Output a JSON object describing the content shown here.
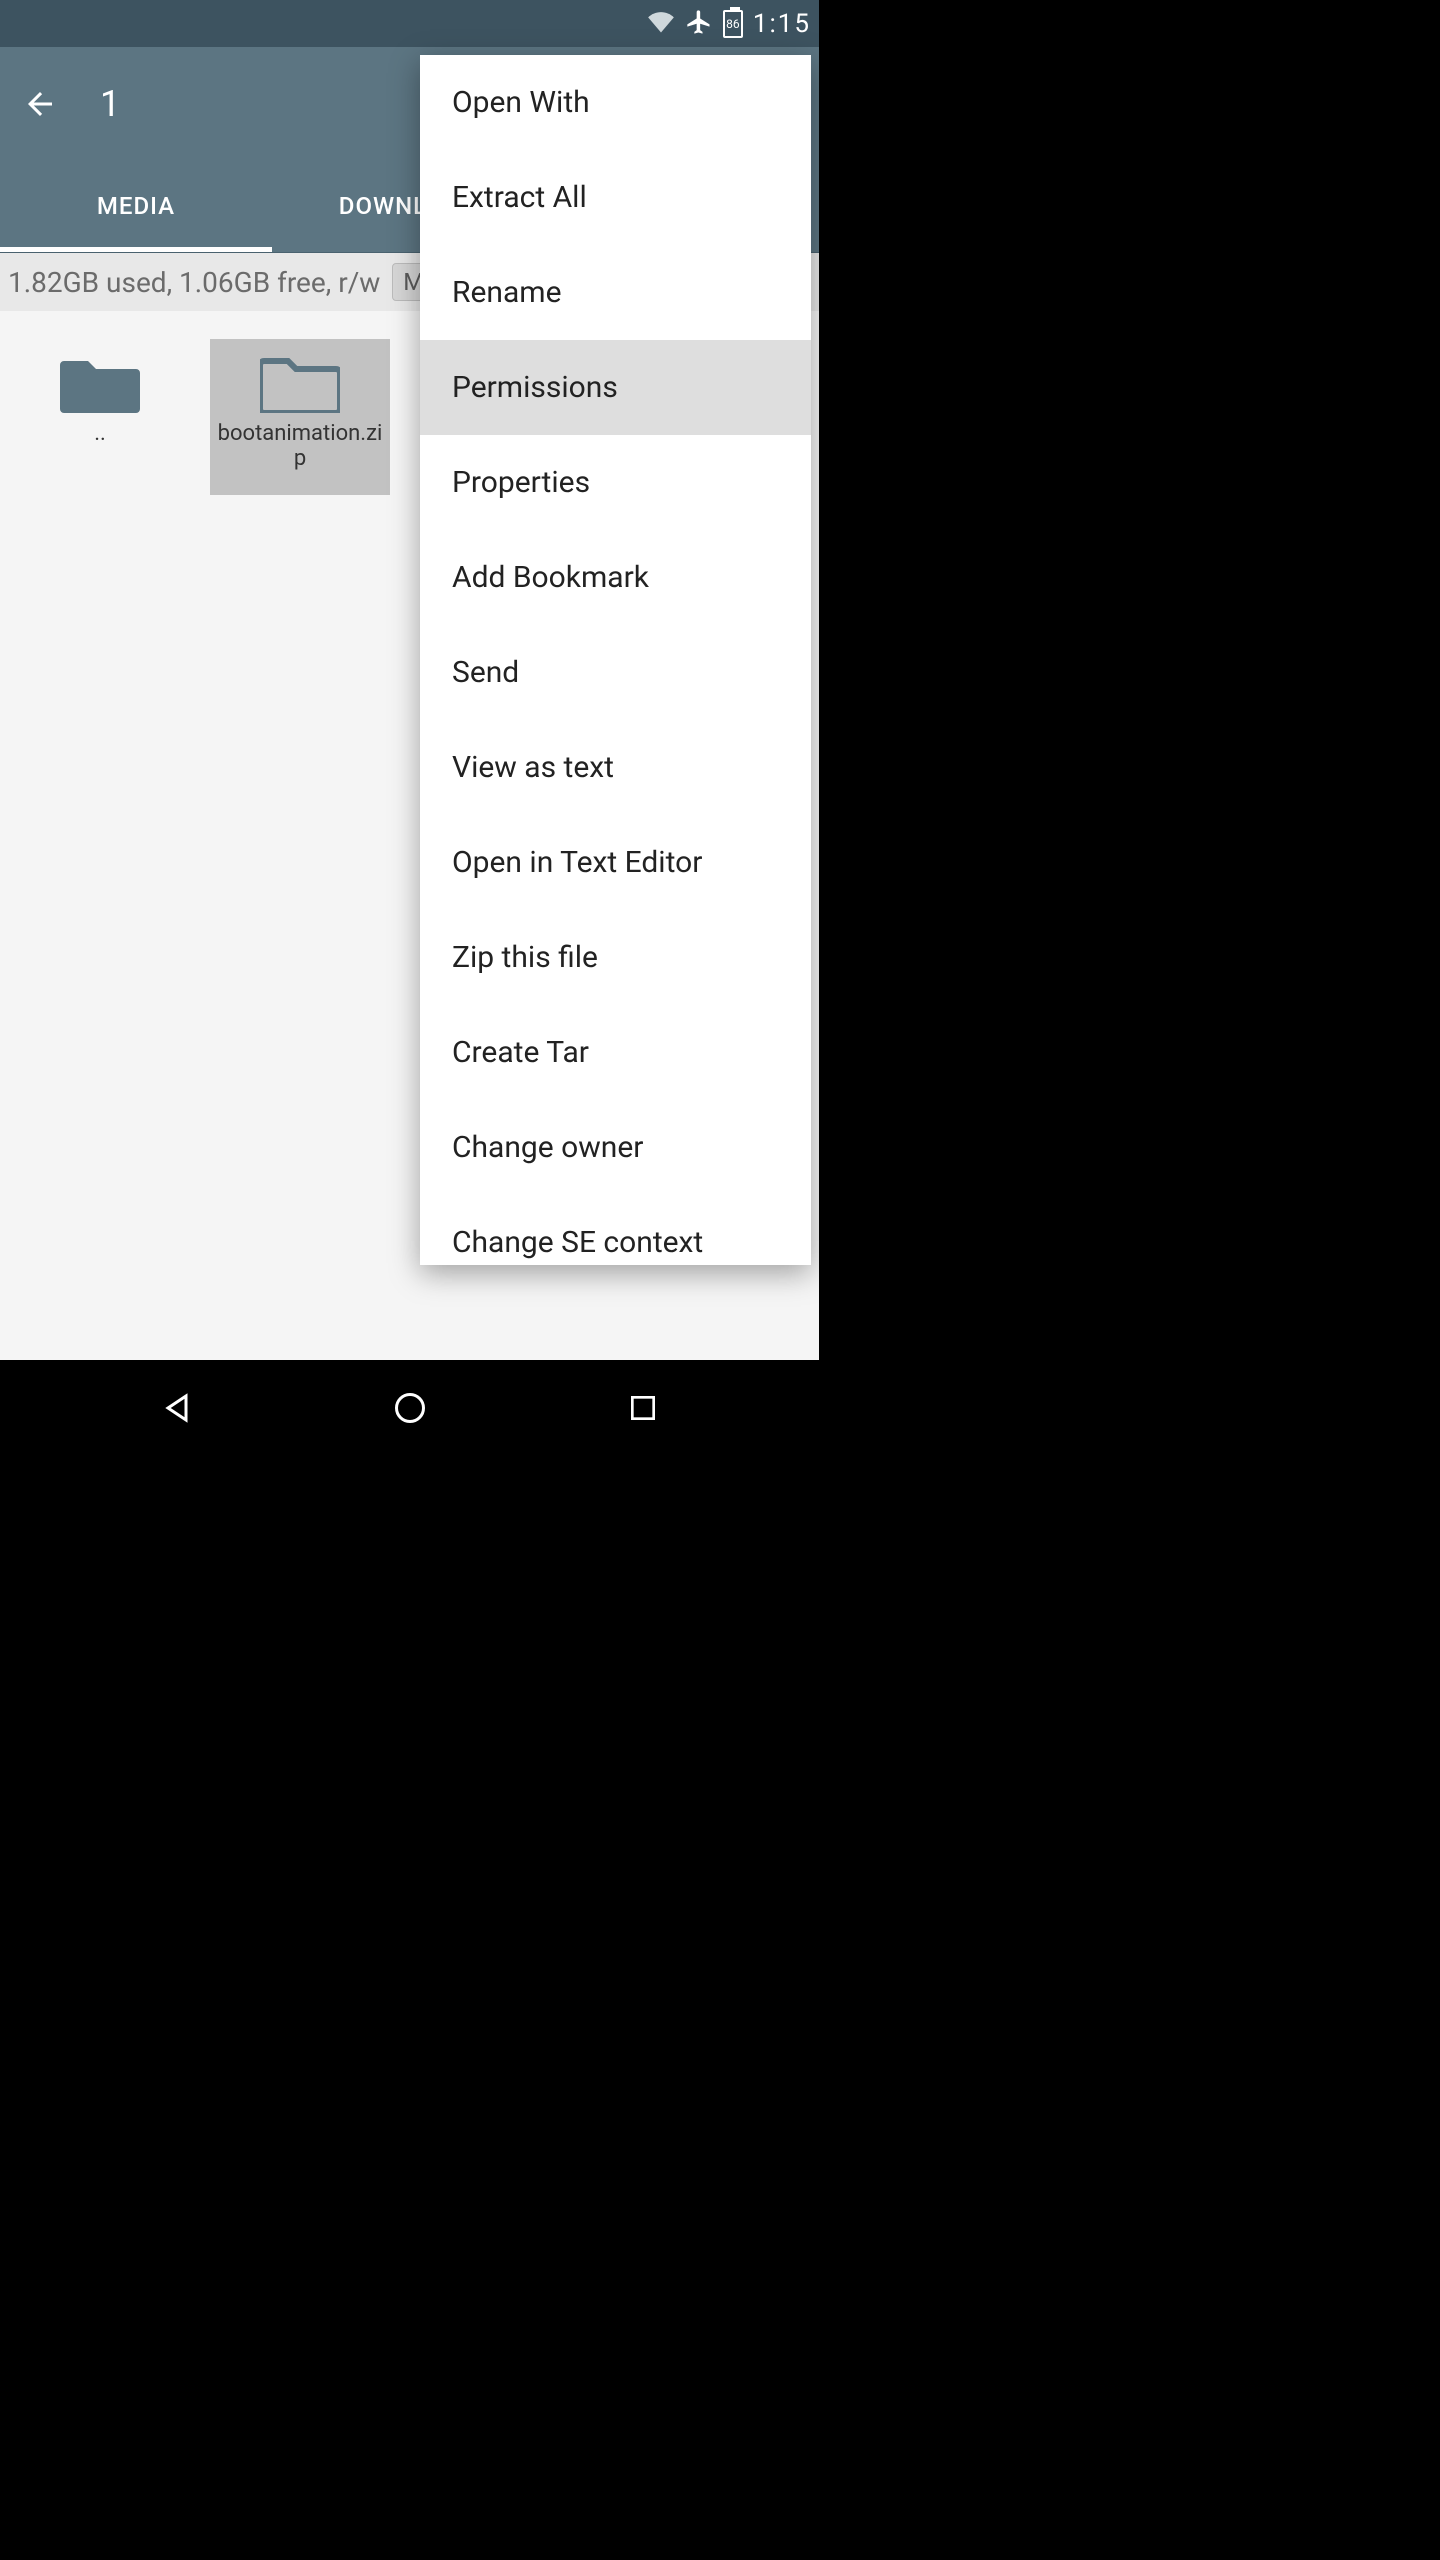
{
  "status": {
    "time": "1:15",
    "battery": "86",
    "airplane": true,
    "wifi": true
  },
  "appbar": {
    "selection_count": "1"
  },
  "tabs": {
    "media": "MEDIA",
    "download": "DOWNLOAD"
  },
  "storage": {
    "info": "1.82GB used, 1.06GB free, r/w",
    "chip": "M"
  },
  "files": {
    "up": "..",
    "items": [
      {
        "name": "bootanimation.zip",
        "selected": true
      }
    ]
  },
  "menu": {
    "open_with": "Open With",
    "extract_all": "Extract All",
    "rename": "Rename",
    "permissions": "Permissions",
    "properties": "Properties",
    "add_bookmark": "Add Bookmark",
    "send": "Send",
    "view_as_text": "View as text",
    "open_in_text_editor": "Open in Text Editor",
    "zip_this_file": "Zip this file",
    "create_tar": "Create Tar",
    "change_owner": "Change owner",
    "change_se_context": "Change SE context"
  }
}
